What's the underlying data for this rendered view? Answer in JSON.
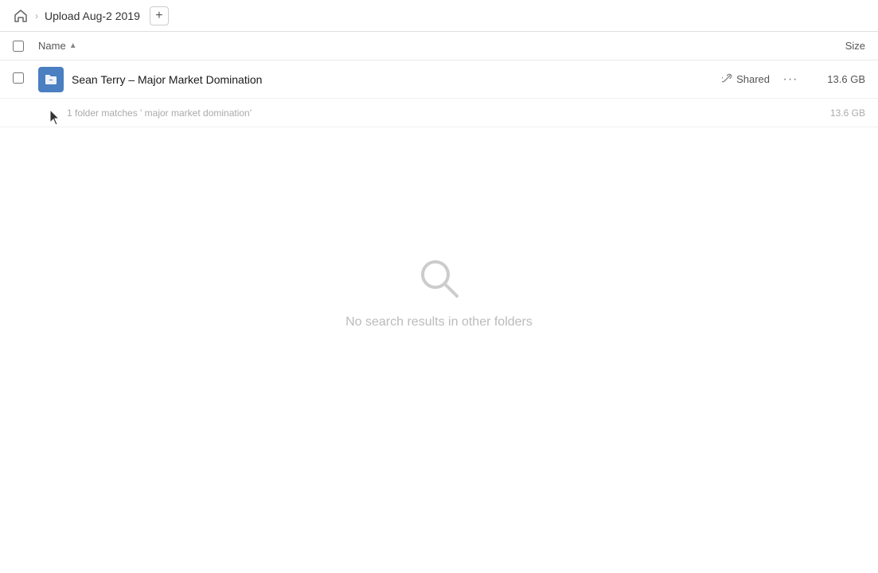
{
  "nav": {
    "home_icon": "🏠",
    "breadcrumb_separator": "›",
    "folder_title": "Upload Aug-2 2019",
    "add_button_label": "+"
  },
  "columns": {
    "name_label": "Name",
    "sort_arrow": "▲",
    "size_label": "Size"
  },
  "file_row": {
    "icon_letter": "🔗",
    "name": "Sean Terry – Major Market Domination",
    "shared_label": "Shared",
    "more_label": "···",
    "size": "13.6 GB"
  },
  "match_row": {
    "text": "1 folder matches ' major market domination'",
    "size": "13.6 GB"
  },
  "empty_state": {
    "label": "No search results in other folders"
  }
}
